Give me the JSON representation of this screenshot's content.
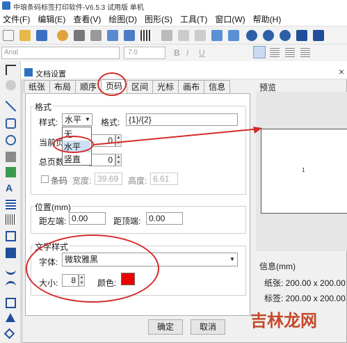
{
  "app": {
    "title": "中琅条码标签打印软件-V6.5.3 试用版 单机"
  },
  "menu": [
    "文件(F)",
    "编辑(E)",
    "查看(V)",
    "绘图(D)",
    "图形(S)",
    "工具(T)",
    "窗口(W)",
    "帮助(H)"
  ],
  "format_bar": {
    "font_value": "Arial",
    "size_value": "7.0"
  },
  "dialog": {
    "title": "文档设置",
    "close": "×",
    "tabs": [
      "纸张",
      "布局",
      "顺序",
      "页码",
      "区间",
      "光标",
      "画布",
      "信息"
    ],
    "active_tab": "页码",
    "format_group": {
      "label": "格式",
      "style_label": "样式:",
      "style_value": "水平",
      "format_label": "格式:",
      "format_value": "{1}/{2}",
      "dropdown_options": [
        "无",
        "水平",
        "竖直"
      ],
      "current_page_label": "当前页",
      "current_page_value": "0",
      "total_pages_label": "总页数",
      "total_pages_value": "0",
      "barcode_label": "条码",
      "width_label": "宽度:",
      "width_value": "39.69",
      "height_label": "高度:",
      "height_value": "6.61"
    },
    "position_group": {
      "label": "位置(mm)",
      "left_label": "距左端:",
      "left_value": "0.00",
      "top_label": "距顶端:",
      "top_value": "0.00"
    },
    "text_style_group": {
      "label": "文字样式",
      "font_label": "字体:",
      "font_value": "微软雅黑",
      "size_label": "大小:",
      "size_value": "8",
      "color_label": "颜色:",
      "color": "#ee0000"
    },
    "preview_label": "预览",
    "preview_page_text": "1",
    "info_label": "信息(mm)",
    "paper_info": "纸张: 200.00 x 200.00",
    "label_info": "标签: 200.00 x 200.00",
    "ok_button": "确定",
    "cancel_button": "取消"
  },
  "watermark": "吉林龙网",
  "colors": {
    "annotation_red": "#d42a2a",
    "accent_blue": "#2d6fc0"
  }
}
